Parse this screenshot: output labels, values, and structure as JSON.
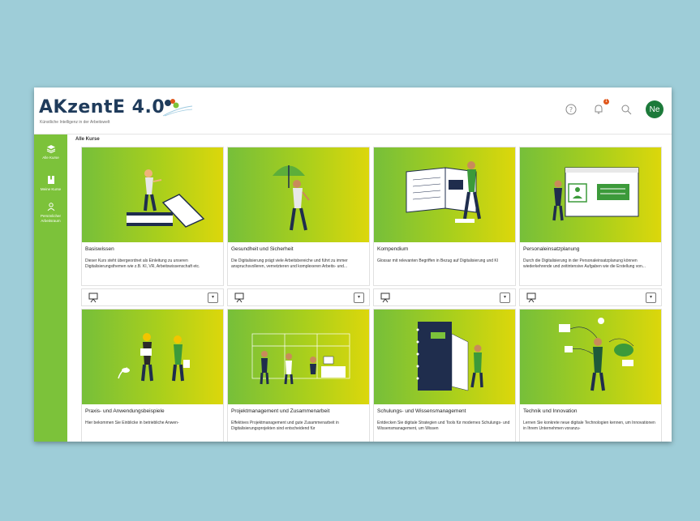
{
  "app": {
    "logo_text": "AKzentE 4.0",
    "logo_subtitle": "Künstliche Intelligenz in der Arbeitswelt",
    "avatar_initials": "Ne",
    "notification_count": "1"
  },
  "sidebar": {
    "items": [
      {
        "label": "Alle Kurse",
        "icon": "layers-icon"
      },
      {
        "label": "Meine Kurse",
        "icon": "bookmark-icon"
      },
      {
        "label": "Persönlicher Arbeitsraum",
        "icon": "person-icon"
      }
    ]
  },
  "breadcrumb": "Alle Kurse",
  "courses": [
    {
      "title": "Basiswissen",
      "description": "Dieser Kurs steht übergeordnet als Einleitung zu unseren Digitalisierungsthemen wie z.B. KI, VR, Arbeitswissenschaft etc."
    },
    {
      "title": "Gesundheit und Sicherheit",
      "description": "Die Digitalisierung prägt viele Arbeitsbereiche und führt zu immer anspruchsvolleren, vernetzteren und komplexeren Arbeits- und..."
    },
    {
      "title": "Kompendium",
      "description": "Glossar mit relevanten Begriffen in Bezug auf Digitalisierung und KI"
    },
    {
      "title": "Personaleinsatzplanung",
      "description": "Durch die Digitalisierung in der Personaleinsatzplanung können wiederkehrende und zeitintensive Aufgaben wie die Erstellung von..."
    },
    {
      "title": "Praxis- und Anwendungsbeispiele",
      "description": "Hier bekommen Sie Einblicke in betriebliche Anwen-"
    },
    {
      "title": "Projektmanagement und Zusammenarbeit",
      "description": "Effektives Projektmanagement und gute Zusammenarbeit in Digitalisierungsprojekten sind entscheidend für"
    },
    {
      "title": "Schulungs- und Wissensmanagement",
      "description": "Entdecken Sie digitale Strategien und Tools für modernes Schulungs- und Wissensmanagement, um Wissen"
    },
    {
      "title": "Technik und Innovation",
      "description": "Lernen Sie konkrete neue digitale Technologien kennen, um Innovationen in Ihrem Unternehmen voranzu-"
    }
  ],
  "colors": {
    "sidebar": "#7cc23a",
    "gradient_start": "#76bf3a",
    "gradient_end": "#dcd70b",
    "avatar": "#1c7a3a",
    "badge": "#e0561a"
  }
}
